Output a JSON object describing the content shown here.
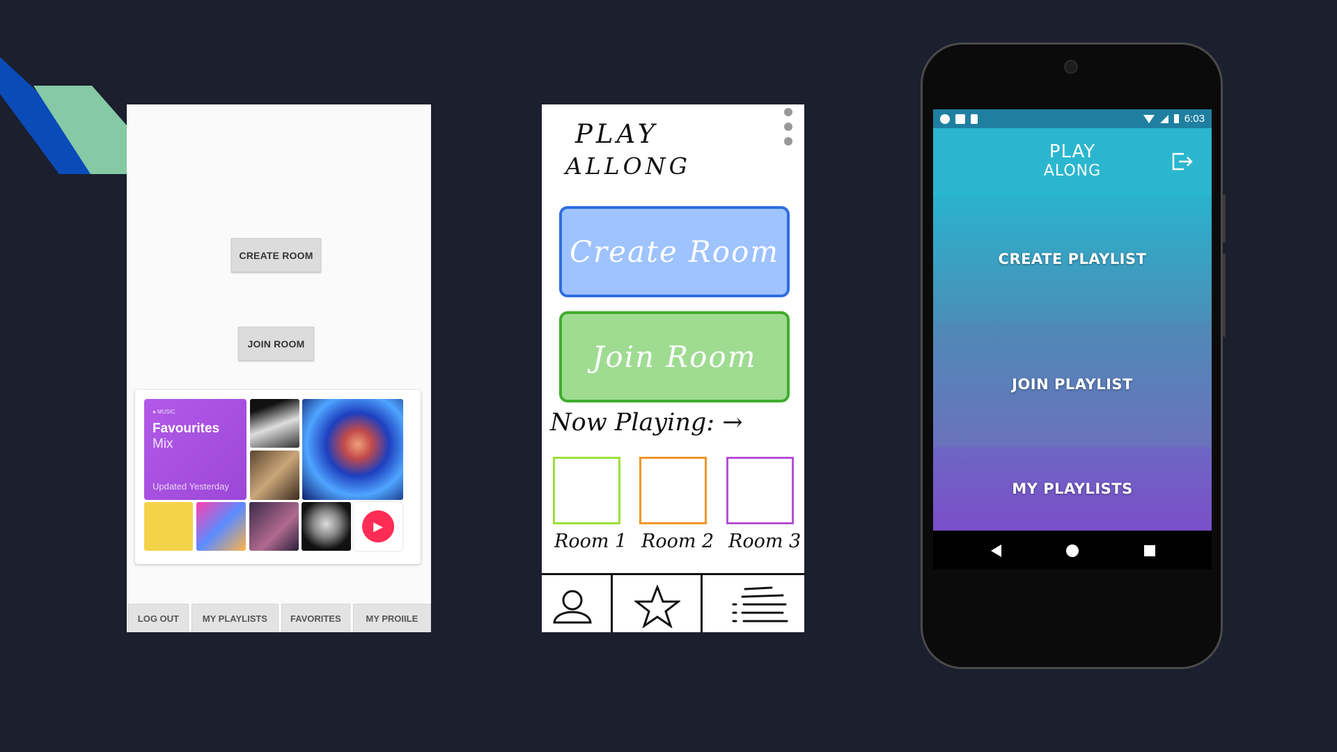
{
  "colors": {
    "background": "#1b1f2e",
    "deco_blue": "#0a4bb8",
    "deco_green": "#86c9a5",
    "sketch_create": "#9ec3ff",
    "sketch_join": "#9fdc92",
    "appbar": "#2bb6cf"
  },
  "lofi": {
    "create_room": "CREATE ROOM",
    "join_room": "JOIN ROOM",
    "music_card": {
      "brand": "● MUSIC",
      "title": "Favourites",
      "subtitle": "Mix",
      "updated": "Updated Yesterday",
      "play_icon": "play-icon"
    },
    "nav": [
      "LOG OUT",
      "MY PLAYLISTS",
      "FAVORITES",
      "MY PROIILE"
    ]
  },
  "sketch": {
    "logo_line1": "PLAY",
    "logo_line2": "ALLONG",
    "create_room": "Create Room",
    "join_room": "Join Room",
    "now_playing": "Now Playing: →",
    "rooms": [
      "Room 1",
      "Room 2",
      "Room 3"
    ],
    "room_colors": [
      "#9be03a",
      "#f0962a",
      "#b74fd6"
    ],
    "tab_icons": [
      "profile-icon",
      "star-icon",
      "list-icon"
    ]
  },
  "phone": {
    "status_time": "6:03",
    "logo_line1": "PLAY",
    "logo_line2": "ALONG",
    "tiles": [
      {
        "label": "CREATE PLAYLIST",
        "color_top": "#2ab2cc",
        "color_bottom": "#4a8fb8"
      },
      {
        "label": "JOIN PLAYLIST",
        "color_top": "#4e8ab6",
        "color_bottom": "#6a72bd"
      },
      {
        "label": "MY PLAYLISTS",
        "color_top": "#6e66c4",
        "color_bottom": "#7a4fc8"
      }
    ],
    "nav_icons": [
      "back-icon",
      "home-icon",
      "recents-icon"
    ]
  }
}
